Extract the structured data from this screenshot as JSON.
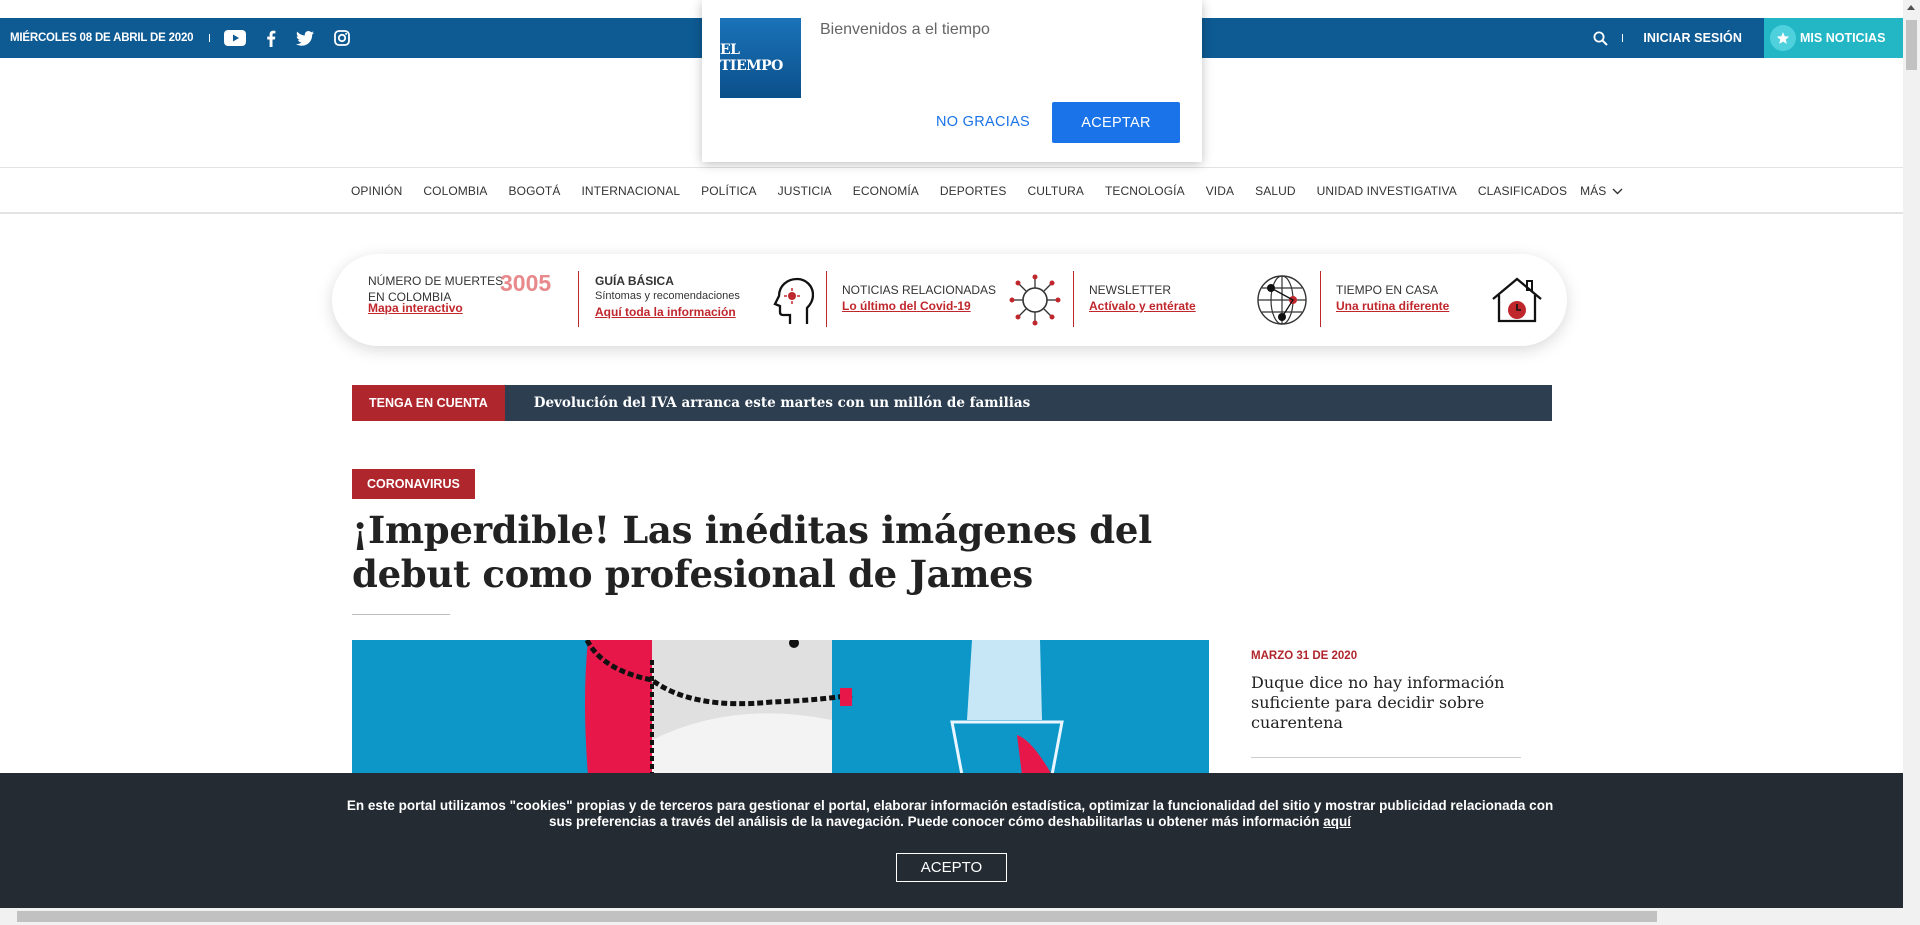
{
  "topbar": {
    "date": "MIÉRCOLES 08 DE ABRIL DE 2020",
    "social_icons": [
      "youtube-icon",
      "facebook-icon",
      "twitter-icon",
      "instagram-icon"
    ],
    "login": "INICIAR SESIÓN",
    "mis_noticias": "MIS NOTICIAS"
  },
  "popup": {
    "logo_text": "EL TIEMPO",
    "welcome": "Bienvenidos a el tiempo",
    "decline": "NO GRACIAS",
    "accept": "ACEPTAR"
  },
  "nav": {
    "items": [
      "OPINIÓN",
      "COLOMBIA",
      "BOGOTÁ",
      "INTERNACIONAL",
      "POLÍTICA",
      "JUSTICIA",
      "ECONOMÍA",
      "DEPORTES",
      "CULTURA",
      "TECNOLOGÍA",
      "VIDA",
      "SALUD",
      "UNIDAD INVESTIGATIVA",
      "CLASIFICADOS"
    ],
    "more": "MÁS"
  },
  "covid_strip": {
    "deaths": {
      "title_line1": "NÚMERO DE MUERTES",
      "title_line2": "EN COLOMBIA",
      "link": "Mapa interactivo",
      "number": "3005"
    },
    "guide": {
      "title": "GUÍA BÁSICA",
      "sub": "Síntomas y recomendaciones",
      "link": "Aquí toda la información"
    },
    "related": {
      "title": "NOTICIAS RELACIONADAS",
      "link": "Lo último del Covid-19"
    },
    "newsletter": {
      "title": "NEWSLETTER",
      "link": "Actívalo y entérate"
    },
    "home": {
      "title": "TIEMPO EN CASA",
      "link": "Una rutina diferente"
    }
  },
  "tenga": {
    "tag": "TENGA EN CUENTA",
    "text": "Devolución del IVA arranca este martes con un millón de familias"
  },
  "article": {
    "category": "CORONAVIRUS",
    "headline": "¡Imperdible! Las inéditas imágenes del debut como profesional de James"
  },
  "side_news": {
    "date": "MARZO 31 DE 2020",
    "title": "Duque dice no hay información suficiente para decidir sobre cuarentena"
  },
  "cookie": {
    "message": "En este portal utilizamos \"cookies\" propias y de terceros para gestionar el portal, elaborar información estadística, optimizar la funcionalidad del sitio y mostrar publicidad relacionada con sus preferencias a través del análisis de la navegación. Puede conocer cómo deshabilitarlas u obtener más información",
    "link": "aquí",
    "button": "ACEPTO"
  },
  "colors": {
    "topbar": "#0e5a93",
    "accent_red": "#b0262d",
    "mis_noticias": "#23b7c6",
    "cookie_bg": "#242b33",
    "popup_button": "#1a73e8"
  }
}
